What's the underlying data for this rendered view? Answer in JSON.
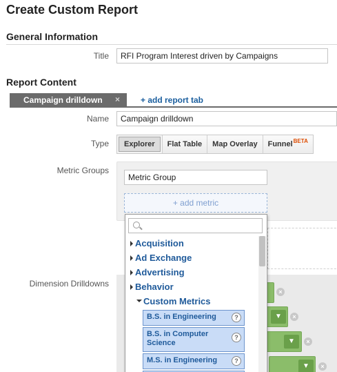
{
  "page": {
    "title": "Create Custom Report"
  },
  "general": {
    "heading": "General Information",
    "title_label": "Title",
    "title_value": "RFI Program Interest driven by Campaigns"
  },
  "content": {
    "heading": "Report Content",
    "active_tab": "Campaign drilldown",
    "tab_close": "×",
    "add_tab": "+ add report tab",
    "name_label": "Name",
    "name_value": "Campaign drilldown",
    "type_label": "Type",
    "types": [
      "Explorer",
      "Flat Table",
      "Map Overlay",
      "Funnel"
    ],
    "selected_type": "Explorer",
    "beta": "BETA",
    "metric_groups_label": "Metric Groups",
    "metric_group_value": "Metric Group",
    "add_metric": "+ add metric",
    "dimension_label": "Dimension Drilldowns"
  },
  "dropdown": {
    "search_placeholder": "",
    "categories": [
      "Acquisition",
      "Ad Exchange",
      "Advertising",
      "Behavior",
      "Custom Metrics"
    ],
    "expanded_category": "Custom Metrics",
    "metrics": [
      "B.S. in Engineering",
      "B.S. in Computer Science",
      "M.S. in Engineering"
    ],
    "help_glyph": "?"
  },
  "colors": {
    "link": "#1a5e9e",
    "category": "#1f5a9a",
    "metric_item_bg": "#c9dcf7",
    "dimension_green": "#8bbd6a",
    "beta": "#dd4b00",
    "active_tab": "#6b6b6b"
  },
  "icons": [
    "close-icon",
    "search-icon",
    "help-icon",
    "chevron-down-icon",
    "remove-icon"
  ]
}
